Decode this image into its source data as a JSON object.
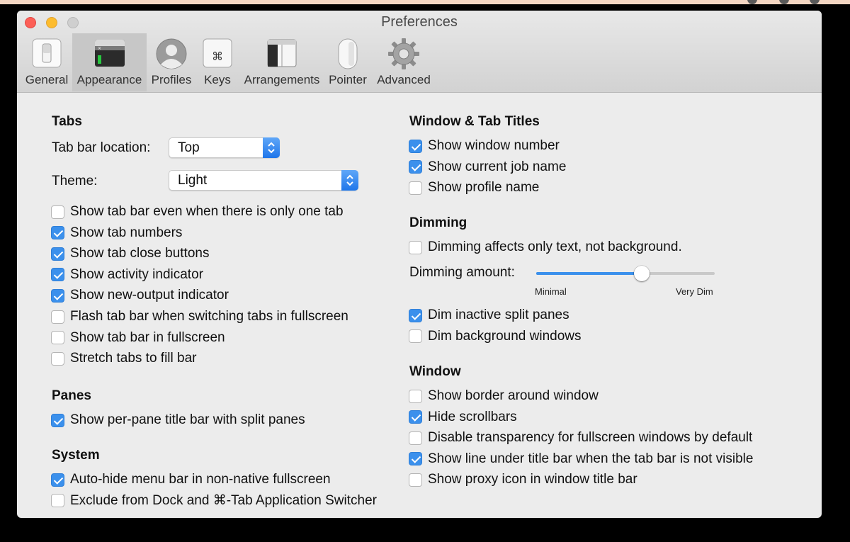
{
  "window": {
    "title": "Preferences"
  },
  "toolbar": [
    {
      "label": "General",
      "icon": "general-switch-icon"
    },
    {
      "label": "Appearance",
      "icon": "appearance-terminal-icon",
      "selected": true
    },
    {
      "label": "Profiles",
      "icon": "profile-silhouette-icon"
    },
    {
      "label": "Keys",
      "icon": "command-key-icon"
    },
    {
      "label": "Arrangements",
      "icon": "window-arrangement-icon"
    },
    {
      "label": "Pointer",
      "icon": "mouse-icon"
    },
    {
      "label": "Advanced",
      "icon": "gear-icon"
    }
  ],
  "tabs": {
    "heading": "Tabs",
    "tab_bar_location_label": "Tab bar location:",
    "tab_bar_location_value": "Top",
    "theme_label": "Theme:",
    "theme_value": "Light",
    "options": [
      {
        "label": "Show tab bar even when there is only one tab",
        "checked": false
      },
      {
        "label": "Show tab numbers",
        "checked": true
      },
      {
        "label": "Show tab close buttons",
        "checked": true
      },
      {
        "label": "Show activity indicator",
        "checked": true
      },
      {
        "label": "Show new-output indicator",
        "checked": true
      },
      {
        "label": "Flash tab bar when switching tabs in fullscreen",
        "checked": false
      },
      {
        "label": "Show tab bar in fullscreen",
        "checked": false
      },
      {
        "label": "Stretch tabs to fill bar",
        "checked": false
      }
    ]
  },
  "panes": {
    "heading": "Panes",
    "options": [
      {
        "label": "Show per-pane title bar with split panes",
        "checked": true
      }
    ]
  },
  "system": {
    "heading": "System",
    "options": [
      {
        "label": "Auto-hide menu bar in non-native fullscreen",
        "checked": true
      },
      {
        "label": "Exclude from Dock and ⌘-Tab Application Switcher",
        "checked": false
      }
    ]
  },
  "window_tab_titles": {
    "heading": "Window & Tab Titles",
    "options": [
      {
        "label": "Show window number",
        "checked": true
      },
      {
        "label": "Show current job name",
        "checked": true
      },
      {
        "label": "Show profile name",
        "checked": false
      }
    ]
  },
  "dimming": {
    "heading": "Dimming",
    "options_top": [
      {
        "label": "Dimming affects only text, not background.",
        "checked": false
      }
    ],
    "amount_label": "Dimming amount:",
    "amount_fraction": 0.59,
    "min_label": "Minimal",
    "max_label": "Very Dim",
    "options_bottom": [
      {
        "label": "Dim inactive split panes",
        "checked": true
      },
      {
        "label": "Dim background windows",
        "checked": false
      }
    ]
  },
  "window_section": {
    "heading": "Window",
    "options": [
      {
        "label": "Show border around window",
        "checked": false
      },
      {
        "label": "Hide scrollbars",
        "checked": true
      },
      {
        "label": "Disable transparency for fullscreen windows by default",
        "checked": false
      },
      {
        "label": "Show line under title bar when the tab bar is not visible",
        "checked": true
      },
      {
        "label": "Show proxy icon in window title bar",
        "checked": false
      }
    ]
  },
  "colors": {
    "accent": "#3b90ec",
    "close": "#fc5f57",
    "minimize": "#fdbc2e"
  }
}
